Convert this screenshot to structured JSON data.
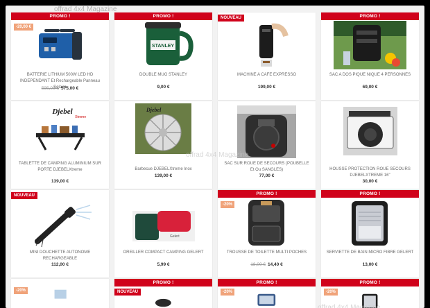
{
  "watermark": "offrad 4x4 Magazine",
  "labels": {
    "promo": "PROMO !",
    "new": "NOUVEAU"
  },
  "products": [
    {
      "title": "BATTERIE LITHIUM 500W LED HD INDEPENDANT Et Rechargeable Panneau Solaire",
      "old_price": "595,00 €",
      "price": "575,00 €",
      "discount": "-20,00 €"
    },
    {
      "title": "DOUBLE MUG STANLEY",
      "price": "9,00 €"
    },
    {
      "title": "MACHINE A CAFE EXPRESSO",
      "price": "199,00 €"
    },
    {
      "title": "SAC A DOS PIQUE NIQUE 4 PERSONNES",
      "price": "69,00 €"
    },
    {
      "title": "TABLETTE DE CAMPING ALUMINIUM SUR PORTE DJEBELXtreme",
      "price": "139,00 €"
    },
    {
      "title": "Barbecue DJEBELXtreme Inox",
      "price": "139,00 €"
    },
    {
      "title": "SAC SUR ROUE DE SECOURS (POUBELLE Et Ou SANGLES)",
      "price": "77,00 €"
    },
    {
      "title": "HOUSSE PROTECTION ROUE SECOURS DJEBELXTREME 16\"",
      "price": "30,00 €"
    },
    {
      "title": "MINI DOUCHETTE AUTONOME RECHARGEABLE",
      "price": "112,00 €"
    },
    {
      "title": "OREILLER COMPACT CAMPING GELERT",
      "price": "5,99 €"
    },
    {
      "title": "TROUSSE DE TOILETTE MULTI POCHES",
      "old_price": "18,00 €",
      "price": "14,40 €",
      "discount": "-20%"
    },
    {
      "title": "SERVIETTE DE BAIN MICRO FIBRE GELERT",
      "price": "13,00 €"
    },
    {
      "discount": "-20%"
    },
    {},
    {
      "discount": "-20%"
    },
    {
      "discount": "-20%"
    }
  ],
  "brand_text": {
    "stanley": "STANLEY",
    "djebel": "Djebel",
    "djebel_sub": "Xtreme",
    "gelert": "Gelert"
  }
}
